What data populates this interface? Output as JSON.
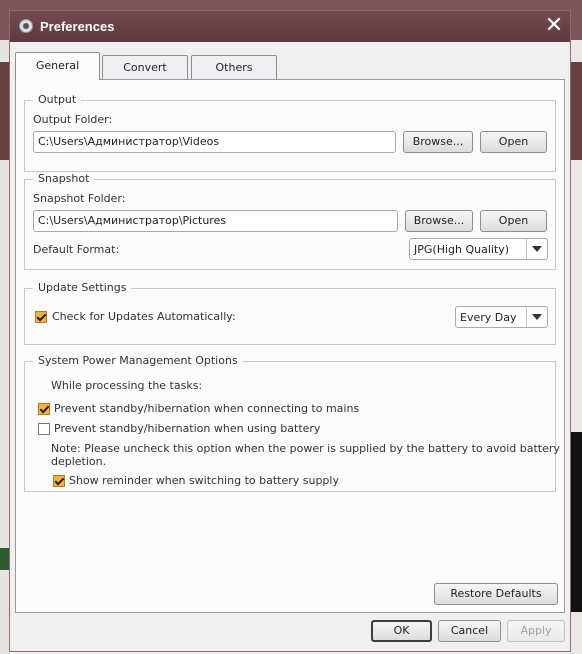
{
  "window": {
    "title": "Preferences",
    "close_glyph": "✕"
  },
  "tabs": [
    {
      "label": "General",
      "active": true
    },
    {
      "label": "Convert",
      "active": false
    },
    {
      "label": "Others",
      "active": false
    }
  ],
  "output": {
    "group_title": "Output",
    "folder_label": "Output Folder:",
    "folder_value": "C:\\Users\\Администратор\\Videos",
    "browse_label": "Browse...",
    "open_label": "Open"
  },
  "snapshot": {
    "group_title": "Snapshot",
    "folder_label": "Snapshot Folder:",
    "folder_value": "C:\\Users\\Администратор\\Pictures",
    "browse_label": "Browse...",
    "open_label": "Open",
    "format_label": "Default Format:",
    "format_value": "JPG(High Quality)"
  },
  "update": {
    "group_title": "Update Settings",
    "check_label": "Check for Updates Automatically:",
    "check_checked": true,
    "frequency_value": "Every Day"
  },
  "power": {
    "group_title": "System Power Management Options",
    "while_label": "While processing the tasks:",
    "prevent_mains_label": "Prevent standby/hibernation when connecting to mains",
    "prevent_mains_checked": true,
    "prevent_battery_label": "Prevent standby/hibernation when using battery",
    "prevent_battery_checked": false,
    "note_line1": "Note: Please uncheck this option when the power is supplied by the battery to avoid battery",
    "note_line2": "depletion.",
    "reminder_label": "Show reminder when switching to battery supply",
    "reminder_checked": true
  },
  "footer": {
    "restore_label": "Restore Defaults",
    "ok_label": "OK",
    "cancel_label": "Cancel",
    "apply_label": "Apply"
  },
  "colors": {
    "titlebar": "#744a50",
    "checkbox_checked": "#f6b03f"
  }
}
